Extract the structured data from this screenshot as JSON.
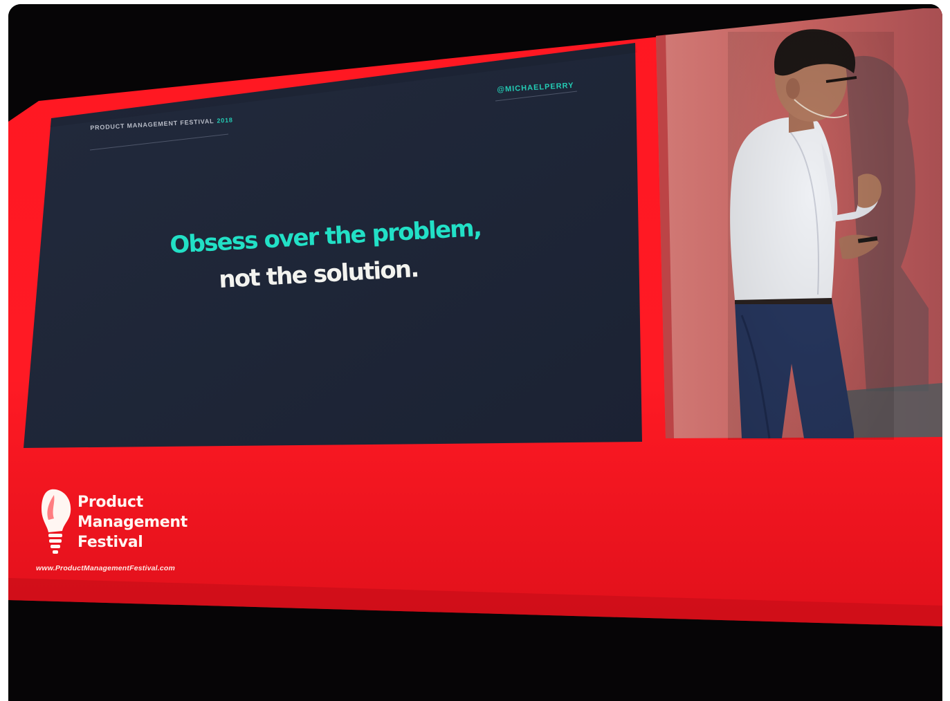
{
  "slide": {
    "event_label": "PRODUCT MANAGEMENT FESTIVAL",
    "event_year": "2018",
    "speaker_handle": "@MICHAELPERRY",
    "quote_line_1": "Obsess over the problem,",
    "quote_line_2": "not the solution."
  },
  "banner": {
    "brand_line_1": "Product",
    "brand_line_2": "Management",
    "brand_line_3": "Festival",
    "website": "www.ProductManagementFestival.com"
  },
  "colors": {
    "stage_red": "#ff1a24",
    "slide_navy": "#1e2537",
    "accent_teal": "#22e0c6",
    "stage_backdrop": "#c76a68"
  }
}
